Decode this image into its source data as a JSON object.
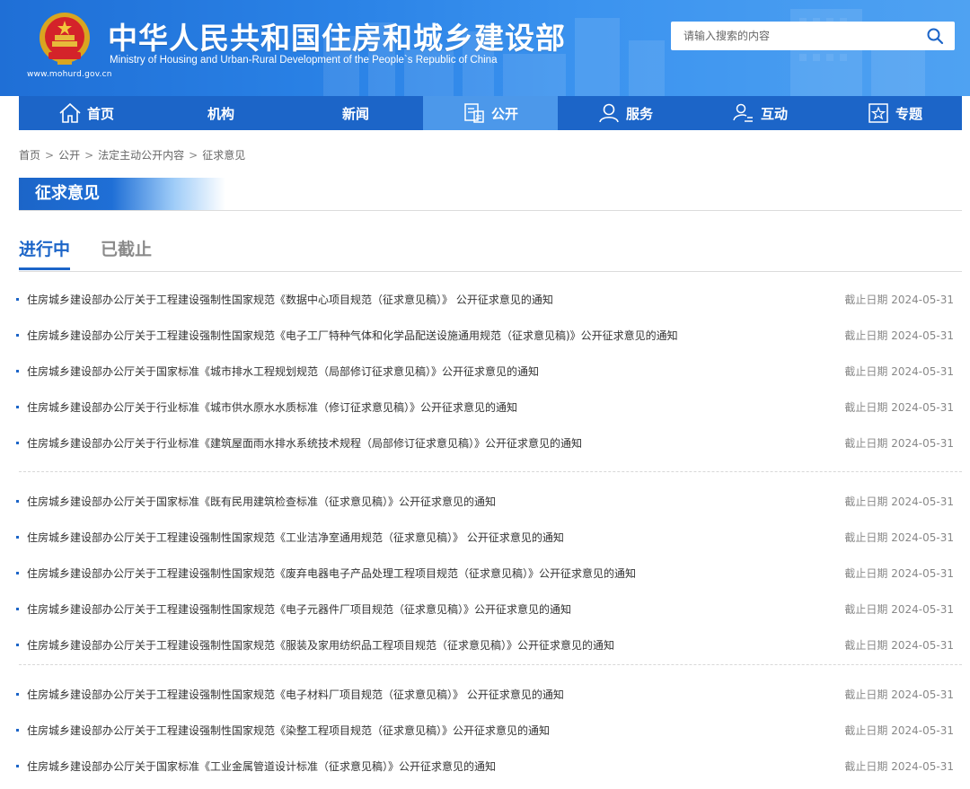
{
  "header": {
    "title": "中华人民共和国住房和城乡建设部",
    "subtitle": "Ministry of Housing and Urban-Rural Development of the People`s Republic of China",
    "url": "www.mohurd.gov.cn",
    "search_placeholder": "请输入搜索的内容"
  },
  "nav": {
    "items": [
      {
        "label": "首页",
        "icon": "home-icon"
      },
      {
        "label": "机构",
        "icon": ""
      },
      {
        "label": "新闻",
        "icon": ""
      },
      {
        "label": "公开",
        "icon": "document-icon",
        "active": true
      },
      {
        "label": "服务",
        "icon": "user-icon"
      },
      {
        "label": "互动",
        "icon": "user-edit-icon"
      },
      {
        "label": "专题",
        "icon": "star-icon"
      }
    ]
  },
  "breadcrumb": {
    "items": [
      "首页",
      "公开",
      "法定主动公开内容",
      "征求意见"
    ],
    "separator": ">"
  },
  "section": {
    "title": "征求意见"
  },
  "tabs": {
    "active": "进行中",
    "closed": "已截止"
  },
  "list": {
    "deadline_prefix": "截止日期",
    "groups": [
      [
        {
          "title": "住房城乡建设部办公厅关于工程建设强制性国家规范《数据中心项目规范（征求意见稿）》 公开征求意见的通知",
          "date": "2024-05-31"
        },
        {
          "title": "住房城乡建设部办公厅关于工程建设强制性国家规范《电子工厂特种气体和化学品配送设施通用规范（征求意见稿)》公开征求意见的通知",
          "date": "2024-05-31"
        },
        {
          "title": "住房城乡建设部办公厅关于国家标准《城市排水工程规划规范（局部修订征求意见稿）》公开征求意见的通知",
          "date": "2024-05-31"
        },
        {
          "title": "住房城乡建设部办公厅关于行业标准《城市供水原水水质标准（修订征求意见稿）》公开征求意见的通知",
          "date": "2024-05-31"
        },
        {
          "title": "住房城乡建设部办公厅关于行业标准《建筑屋面雨水排水系统技术规程（局部修订征求意见稿）》公开征求意见的通知",
          "date": "2024-05-31"
        }
      ],
      [
        {
          "title": "住房城乡建设部办公厅关于国家标准《既有民用建筑检查标准（征求意见稿）》公开征求意见的通知",
          "date": "2024-05-31"
        },
        {
          "title": "住房城乡建设部办公厅关于工程建设强制性国家规范《工业洁净室通用规范（征求意见稿）》 公开征求意见的通知",
          "date": "2024-05-31"
        },
        {
          "title": "住房城乡建设部办公厅关于工程建设强制性国家规范《废弃电器电子产品处理工程项目规范（征求意见稿）》公开征求意见的通知",
          "date": "2024-05-31"
        },
        {
          "title": "住房城乡建设部办公厅关于工程建设强制性国家规范《电子元器件厂项目规范（征求意见稿）》公开征求意见的通知",
          "date": "2024-05-31"
        },
        {
          "title": "住房城乡建设部办公厅关于工程建设强制性国家规范《服装及家用纺织品工程项目规范（征求意见稿）》公开征求意见的通知",
          "date": "2024-05-31"
        }
      ],
      [
        {
          "title": "住房城乡建设部办公厅关于工程建设强制性国家规范《电子材料厂项目规范（征求意见稿）》 公开征求意见的通知",
          "date": "2024-05-31"
        },
        {
          "title": "住房城乡建设部办公厅关于工程建设强制性国家规范《染整工程项目规范（征求意见稿）》公开征求意见的通知",
          "date": "2024-05-31"
        },
        {
          "title": "住房城乡建设部办公厅关于国家标准《工业金属管道设计标准（征求意见稿）》公开征求意见的通知",
          "date": "2024-05-31"
        }
      ]
    ]
  },
  "colors": {
    "primary": "#1c65c8",
    "nav_active": "#4c98ea",
    "header_bg": "#2a82e6"
  }
}
